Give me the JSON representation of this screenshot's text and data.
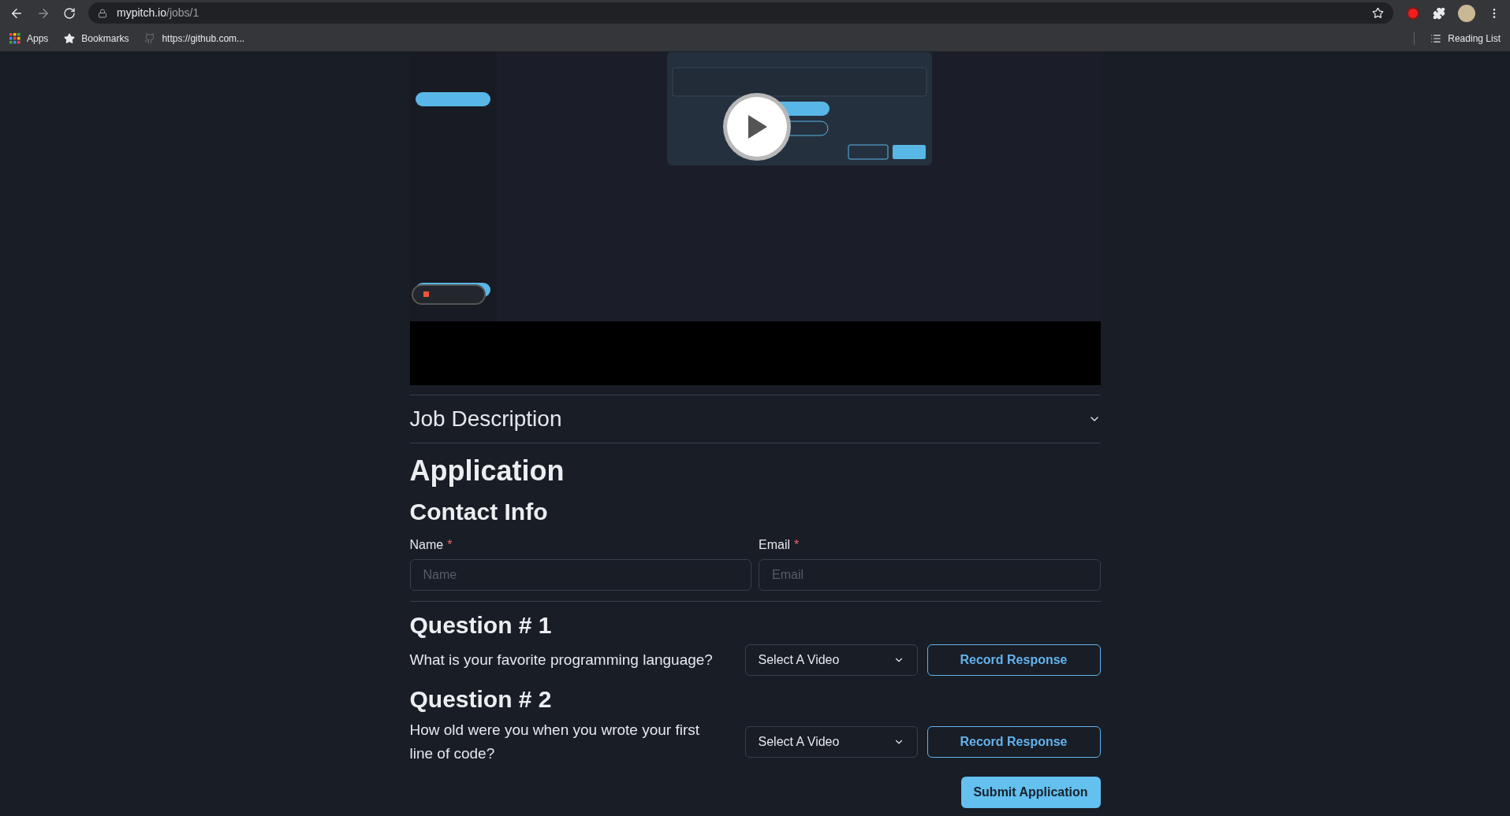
{
  "browser": {
    "url_host": "mypitch.io",
    "url_path": "/jobs/1",
    "bookmarks": [
      {
        "label": "Apps",
        "kind": "apps"
      },
      {
        "label": "Bookmarks",
        "kind": "star"
      },
      {
        "label": "https://github.com...",
        "kind": "github"
      }
    ],
    "reading_list": "Reading List"
  },
  "accordion": {
    "title": "Job Description",
    "expanded": false
  },
  "application": {
    "title": "Application",
    "contact_title": "Contact Info",
    "fields": [
      {
        "label": "Name",
        "required_mark": "*",
        "placeholder": "Name"
      },
      {
        "label": "Email",
        "required_mark": "*",
        "placeholder": "Email"
      }
    ],
    "questions": [
      {
        "title": "Question # 1",
        "text": "What is your favorite programming language?",
        "select": "Select A Video",
        "record": "Record Response"
      },
      {
        "title": "Question # 2",
        "text": "How old were you when you wrote your first line of code?",
        "select": "Select A Video",
        "record": "Record Response"
      }
    ],
    "submit": "Submit Application"
  }
}
